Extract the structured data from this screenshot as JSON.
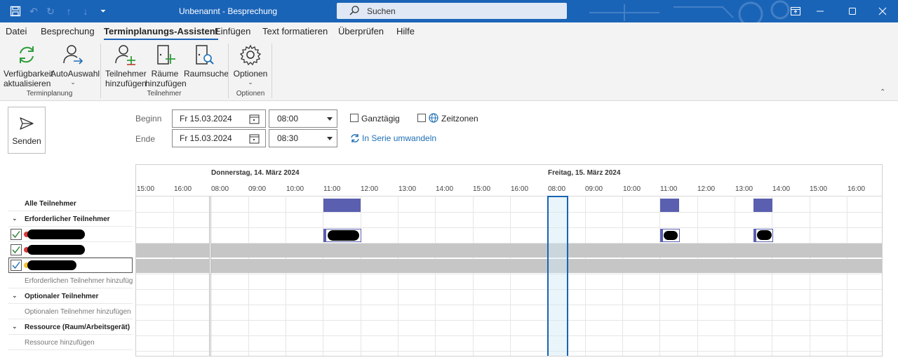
{
  "window": {
    "title": "Unbenannt  -  Besprechung",
    "search_placeholder": "Suchen"
  },
  "menu": {
    "tabs": [
      "Datei",
      "Besprechung",
      "Terminplanungs-Assistent",
      "Einfügen",
      "Text formatieren",
      "Überprüfen",
      "Hilfe"
    ],
    "active_index": 2
  },
  "ribbon": {
    "groups": [
      {
        "label": "Terminplanung",
        "buttons": [
          {
            "label_line1": "Verfügbarkeit",
            "label_line2": "aktualisieren",
            "icon": "refresh-icon"
          },
          {
            "label_line1": "AutoAuswahl",
            "label_line2": "",
            "icon": "auto-select-person-icon",
            "has_dropdown": true
          }
        ]
      },
      {
        "label": "Teilnehmer",
        "buttons": [
          {
            "label_line1": "Teilnehmer",
            "label_line2": "hinzufügen",
            "icon": "add-person-icon"
          },
          {
            "label_line1": "Räume",
            "label_line2": "hinzufügen",
            "icon": "add-room-icon"
          },
          {
            "label_line1": "Raumsuche",
            "label_line2": "",
            "icon": "room-search-icon"
          }
        ]
      },
      {
        "label": "Optionen",
        "buttons": [
          {
            "label_line1": "Optionen",
            "label_line2": "",
            "icon": "gear-icon",
            "has_dropdown": true
          }
        ]
      }
    ]
  },
  "form": {
    "send_label": "Senden",
    "start": {
      "label": "Beginn",
      "date": "Fr 15.03.2024",
      "time": "08:00"
    },
    "end": {
      "label": "Ende",
      "date": "Fr 15.03.2024",
      "time": "08:30"
    },
    "all_day": {
      "label": "Ganztägig",
      "checked": false
    },
    "time_zones": {
      "label": "Zeitzonen",
      "checked": false
    },
    "recurrence_label": "In Serie umwandeln"
  },
  "schedule": {
    "days": [
      {
        "label": "Donnerstag, 14. März 2024",
        "hours": [
          "08:00",
          "09:00",
          "10:00",
          "11:00",
          "12:00",
          "13:00",
          "14:00",
          "15:00",
          "16:00"
        ]
      },
      {
        "label": "Freitag, 15. März 2024",
        "hours": [
          "08:00",
          "09:00",
          "10:00",
          "11:00",
          "12:00",
          "13:00",
          "14:00",
          "15:00",
          "16:00"
        ]
      }
    ],
    "leading_hours": [
      "15:00",
      "16:00"
    ],
    "meeting": {
      "day": "Freitag",
      "start": "08:00",
      "end": "08:30"
    }
  },
  "attendees": {
    "all_label": "Alle Teilnehmer",
    "required_header": "Erforderlicher Teilnehmer",
    "required": [
      {
        "checked": true,
        "status_color": "#d83b3b",
        "name_redacted": true
      },
      {
        "checked": true,
        "status_color": "#d83b3b",
        "name_redacted": true
      },
      {
        "checked": true,
        "status_color": "#f2c230",
        "name_redacted": true
      }
    ],
    "add_required": "Erforderlichen Teilnehmer hinzufügen",
    "optional_header": "Optionaler Teilnehmer",
    "add_optional": "Optionalen Teilnehmer hinzufügen",
    "resource_header": "Ressource (Raum/Arbeitsgerät)",
    "add_resource": "Ressource hinzufügen"
  },
  "colors": {
    "titlebar": "#1a64b8",
    "busy": "#5a5fb0",
    "selection": "#1765b2",
    "link": "#1f6fb5"
  }
}
